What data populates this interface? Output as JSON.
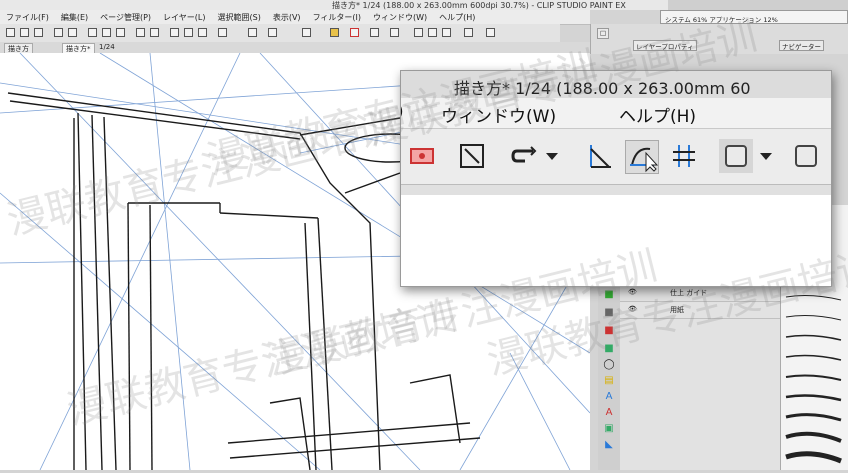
{
  "window": {
    "title": "描き方* 1/24 (188.00 x 263.00mm 600dpi 30.7%) - CLIP STUDIO PAINT EX",
    "sysinfo": "システム 61% アプリケーション 12%"
  },
  "menu": [
    {
      "name": "file",
      "label": "ファイル(F)"
    },
    {
      "name": "edit",
      "label": "編集(E)"
    },
    {
      "name": "page",
      "label": "ページ管理(P)"
    },
    {
      "name": "layer",
      "label": "レイヤー(L)"
    },
    {
      "name": "selection",
      "label": "選択範囲(S)"
    },
    {
      "name": "view",
      "label": "表示(V)"
    },
    {
      "name": "filter",
      "label": "フィルター(I)"
    },
    {
      "name": "window",
      "label": "ウィンドウ(W)"
    },
    {
      "name": "help",
      "label": "ヘルプ(H)"
    }
  ],
  "tabs": {
    "doc1": "描き方",
    "doc2": "描き方*",
    "page_indicator": "1/24"
  },
  "right_panel": {
    "layer_property": "レイヤープロパティ",
    "navigator": "ナビゲーター",
    "layers": [
      "仕上 ガイド",
      "用紙"
    ]
  },
  "zoom": {
    "title": "描き方* 1/24 (188.00 x 263.00mm 60",
    "paren_fragment": ")",
    "menu_window": "ウィンドウ(W)",
    "menu_help": "ヘルプ(H)",
    "icons": [
      "record-icon",
      "line-icon",
      "undo-redo-icon",
      "dropdown-arrow-icon",
      "ruler-perspective-icon",
      "curve-ruler-icon",
      "grid-ruler-icon",
      "color-square-icon",
      "dropdown-arrow-icon",
      "color-square-icon"
    ]
  },
  "watermark": "漫联教育专注漫画培训",
  "colors": {
    "sketch_blue": "#7fa3d6",
    "ink": "#1a1a1a",
    "toolbar_bg": "#ececec",
    "accent_red": "#d94040"
  }
}
